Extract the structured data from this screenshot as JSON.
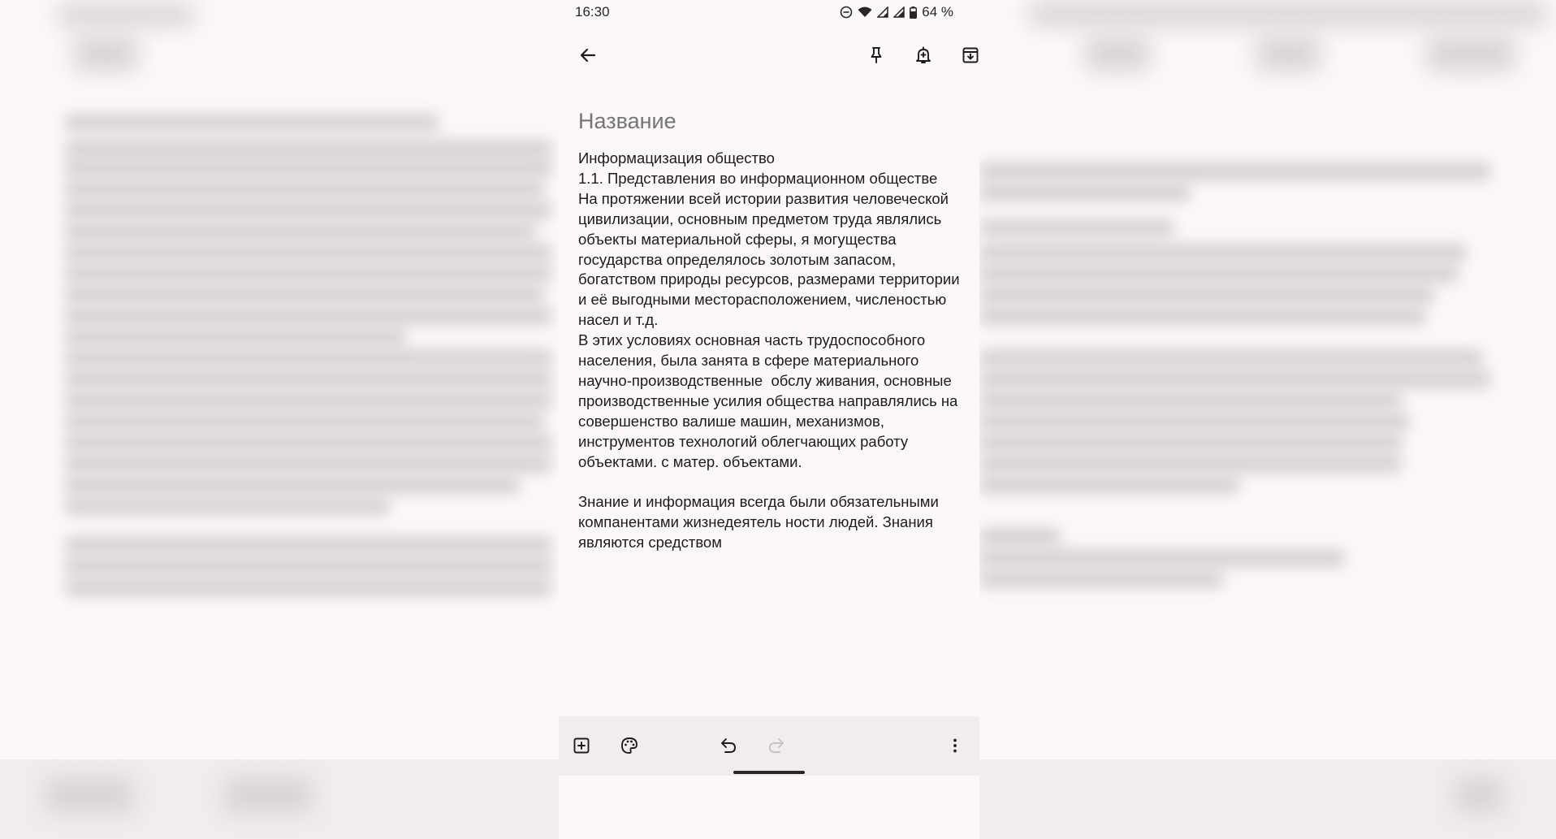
{
  "status_bar": {
    "time": "16:30",
    "battery": "64 %"
  },
  "toolbar": {
    "back_icon": "arrow-back-icon",
    "pin_icon": "pin-icon",
    "reminder_icon": "bell-plus-icon",
    "archive_icon": "archive-icon"
  },
  "note": {
    "title_placeholder": "Название",
    "body": "Информацизация общество\n1.1. Представления во информационном обществе\nНа протяжении всей истории развития человеческой цивилизации, основным предметом труда являлись объекты материальной сферы, я могущества государства определялось золотым запасом, богатством природы ресурсов, размерами территории и её выгодными месторасположением, численостью насел и т.д.\nВ этих условиях основная часть трудоспособного населения, была занята в сфере материального научно-производственные  обслу живания, основные производственные усилия общества направлялись на совершенство валише машин, механизмов, инструментов технологий облегчающих работу объектами. с матер. объектами.\n\nЗнание и информация всегда были обязательными компанентами жизнедеятель ности людей. Знания являются средством"
  },
  "bottom_bar": {
    "add_icon": "add-box-icon",
    "palette_icon": "palette-icon",
    "undo_icon": "undo-icon",
    "redo_icon": "redo-icon",
    "more_icon": "more-vert-icon"
  },
  "colors": {
    "background": "#fdf8f8",
    "bottom_bar": "#f3ecec",
    "placeholder": "#9b9595",
    "text": "#1f1b1b"
  }
}
